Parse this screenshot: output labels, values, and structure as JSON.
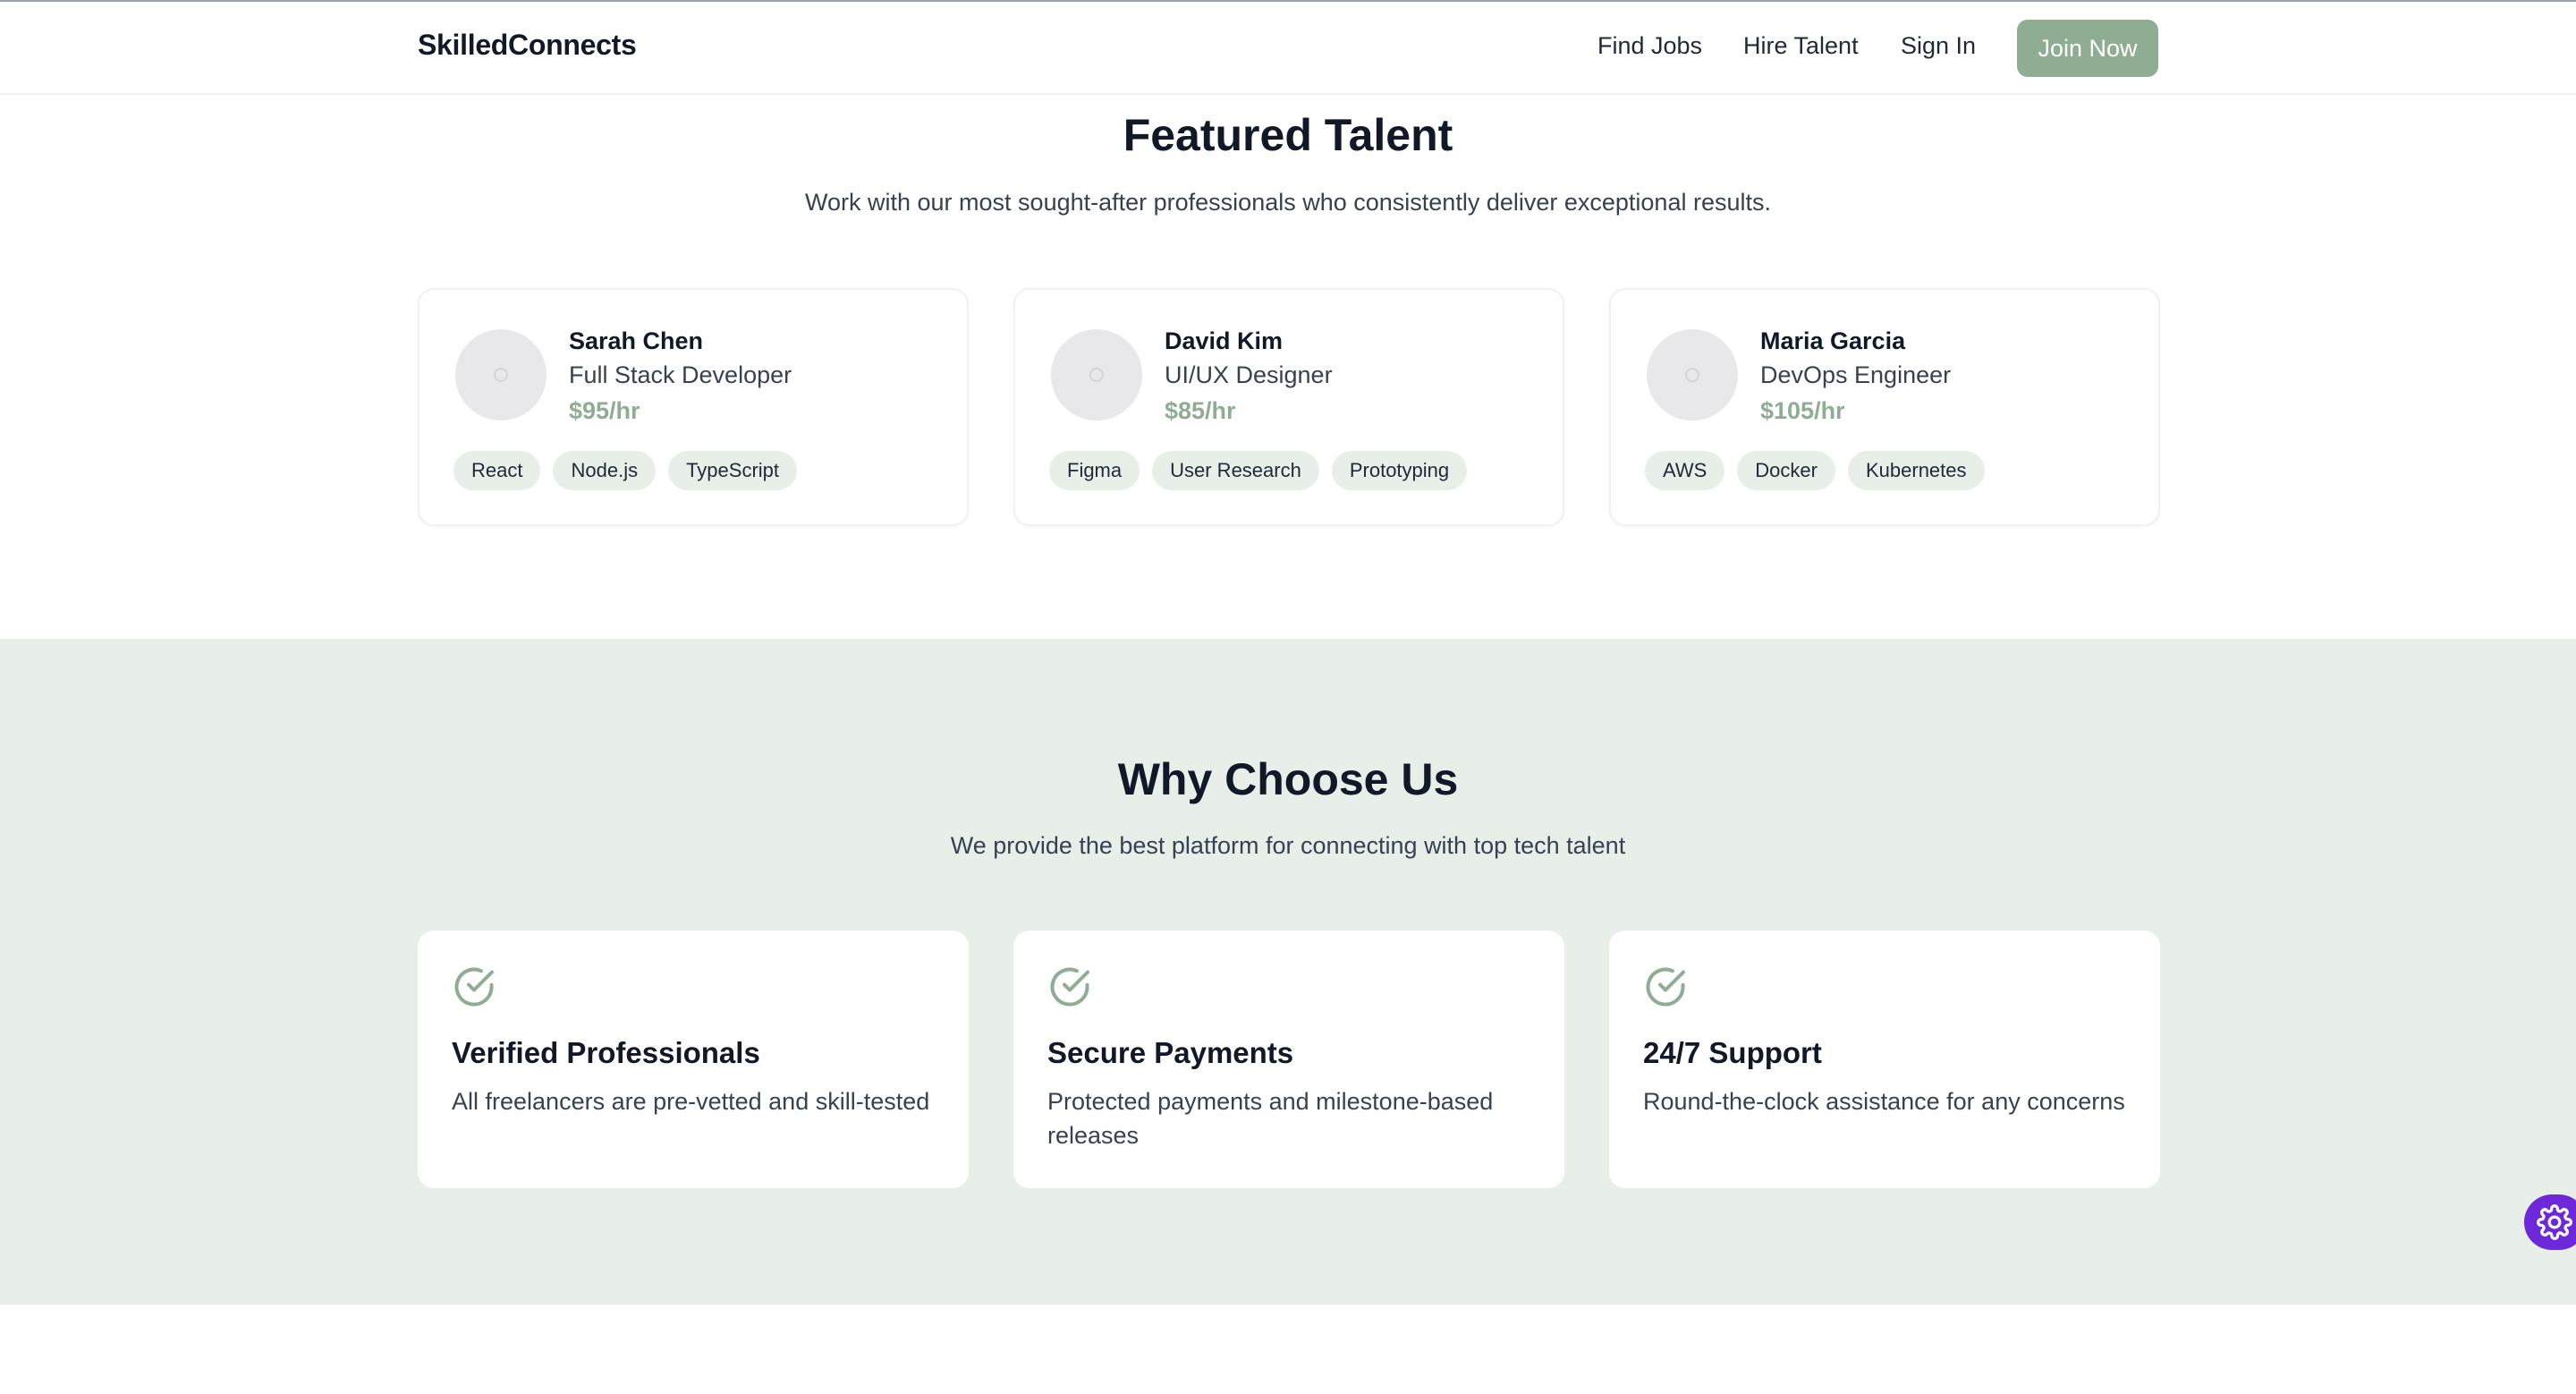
{
  "header": {
    "logo": "SkilledConnects",
    "nav": [
      "Find Jobs",
      "Hire Talent",
      "Sign In"
    ],
    "cta": "Join Now"
  },
  "featured": {
    "title": "Featured Talent",
    "subtitle": "Work with our most sought-after professionals who consistently deliver exceptional results.",
    "talent": [
      {
        "name": "Sarah Chen",
        "role": "Full Stack Developer",
        "rate": "$95/hr",
        "skills": [
          "React",
          "Node.js",
          "TypeScript"
        ]
      },
      {
        "name": "David Kim",
        "role": "UI/UX Designer",
        "rate": "$85/hr",
        "skills": [
          "Figma",
          "User Research",
          "Prototyping"
        ]
      },
      {
        "name": "Maria Garcia",
        "role": "DevOps Engineer",
        "rate": "$105/hr",
        "skills": [
          "AWS",
          "Docker",
          "Kubernetes"
        ]
      }
    ]
  },
  "why": {
    "title": "Why Choose Us",
    "subtitle": "We provide the best platform for connecting with top tech talent",
    "features": [
      {
        "icon": "check-circle-icon",
        "title": "Verified Professionals",
        "description": "All freelancers are pre-vetted and skill-tested"
      },
      {
        "icon": "check-circle-icon",
        "title": "Secure Payments",
        "description": "Protected payments and milestone-based releases"
      },
      {
        "icon": "check-circle-icon",
        "title": "24/7 Support",
        "description": "Round-the-clock assistance for any concerns"
      }
    ]
  },
  "floating": {
    "icon": "gear-icon"
  },
  "colors": {
    "accent": "#8fad92",
    "section_bg": "#e7efe8",
    "tag_bg": "#e8efe8",
    "fab": "#6d28d9"
  }
}
